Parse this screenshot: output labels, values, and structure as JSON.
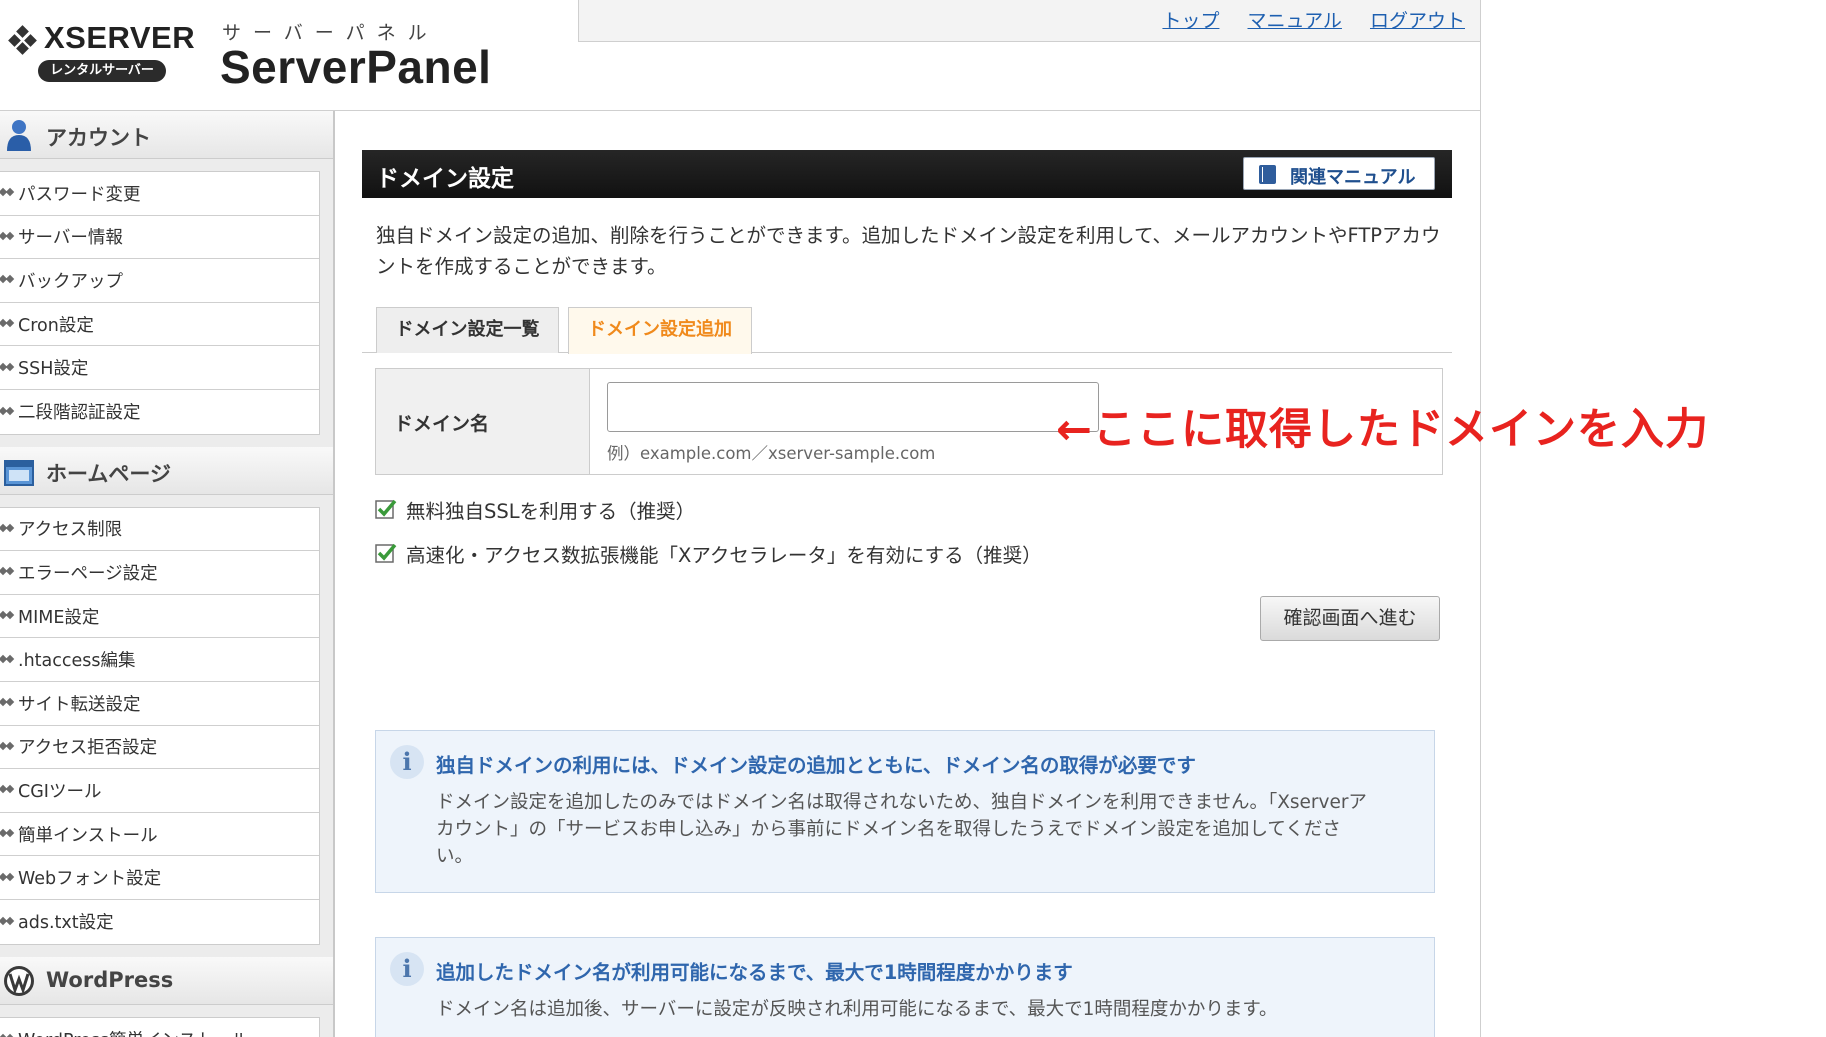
{
  "header": {
    "brand": "XSERVER",
    "brand_badge": "レンタルサーバー",
    "panel_sub": "サーバーパネル",
    "panel_title": "ServerPanel",
    "nav": [
      "トップ",
      "マニュアル",
      "ログアウト"
    ]
  },
  "sidebar": {
    "sections": [
      {
        "title": "アカウント",
        "icon": "user-icon",
        "items": [
          "パスワード変更",
          "サーバー情報",
          "バックアップ",
          "Cron設定",
          "SSH設定",
          "二段階認証設定"
        ]
      },
      {
        "title": "ホームページ",
        "icon": "homepage-icon",
        "items": [
          "アクセス制限",
          "エラーページ設定",
          "MIME設定",
          ".htaccess編集",
          "サイト転送設定",
          "アクセス拒否設定",
          "CGIツール",
          "簡単インストール",
          "Webフォント設定",
          "ads.txt設定"
        ]
      },
      {
        "title": "WordPress",
        "icon": "wordpress-icon",
        "items": [
          "WordPress簡単インストール"
        ]
      }
    ]
  },
  "main": {
    "title": "ドメイン設定",
    "manual_button": "関連マニュアル",
    "description": "独自ドメイン設定の追加、削除を行うことができます。追加したドメイン設定を利用して、メールアカウントやFTPアカウントを作成することができます。",
    "tabs": [
      {
        "label": "ドメイン設定一覧",
        "active": false
      },
      {
        "label": "ドメイン設定追加",
        "active": true
      }
    ],
    "form": {
      "label": "ドメイン名",
      "value": "",
      "example": "例）example.com／xserver-sample.com"
    },
    "annotation": "←ここに取得したドメインを入力",
    "checkboxes": [
      {
        "label": "無料独自SSLを利用する（推奨）",
        "checked": true
      },
      {
        "label": "高速化・アクセス数拡張機能「Xアクセラレータ」を有効にする（推奨）",
        "checked": true
      }
    ],
    "submit": "確認画面へ進む",
    "info": [
      {
        "title": "独自ドメインの利用には、ドメイン設定の追加とともに、ドメイン名の取得が必要です",
        "body": "ドメイン設定を追加したのみではドメイン名は取得されないため、独自ドメインを利用できません。「Xserverアカウント」の「サービスお申し込み」から事前にドメイン名を取得したうえでドメイン設定を追加してください。"
      },
      {
        "title": "追加したドメイン名が利用可能になるまで、最大で1時間程度かかります",
        "body": "ドメイン名は追加後、サーバーに設定が反映され利用可能になるまで、最大で1時間程度かかります。"
      }
    ]
  },
  "colors": {
    "link": "#1d5fb0",
    "active_tab": "#f08a1c",
    "annotation": "#e8231f",
    "info_title": "#2f66ad",
    "check": "#3a9a3a"
  }
}
